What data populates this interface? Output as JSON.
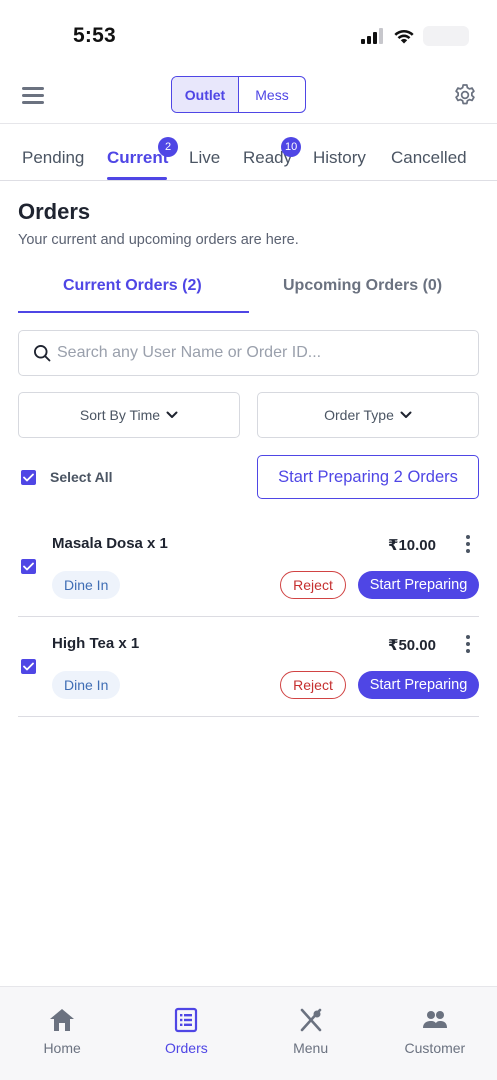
{
  "status_bar": {
    "time": "5:53"
  },
  "header": {
    "segments": [
      "Outlet",
      "Mess"
    ],
    "active_segment": "Outlet"
  },
  "tabs": [
    {
      "label": "Pending"
    },
    {
      "label": "Current",
      "badge": "2"
    },
    {
      "label": "Live"
    },
    {
      "label": "Ready",
      "badge": "10"
    },
    {
      "label": "History"
    },
    {
      "label": "Cancelled"
    }
  ],
  "active_tab": "Current",
  "page": {
    "title": "Orders",
    "subtitle": "Your current and upcoming orders are here."
  },
  "sub_tabs": {
    "current": "Current Orders (2)",
    "upcoming": "Upcoming Orders (0)"
  },
  "search": {
    "placeholder": "Search any User Name or Order ID..."
  },
  "filters": {
    "sort": "Sort By Time",
    "type": "Order Type"
  },
  "select_all": {
    "label": "Select All",
    "checked": true
  },
  "bulk_action": {
    "label": "Start Preparing 2 Orders"
  },
  "orders": [
    {
      "name": "Masala Dosa x 1",
      "price": "₹10.00",
      "tag": "Dine In",
      "reject": "Reject",
      "start": "Start Preparing",
      "checked": true
    },
    {
      "name": "High Tea x 1",
      "price": "₹50.00",
      "tag": "Dine In",
      "reject": "Reject",
      "start": "Start Preparing",
      "checked": true
    }
  ],
  "bottom_nav": [
    {
      "label": "Home",
      "icon": "home-icon"
    },
    {
      "label": "Orders",
      "icon": "orders-icon",
      "active": true
    },
    {
      "label": "Menu",
      "icon": "utensils-icon"
    },
    {
      "label": "Customer",
      "icon": "people-icon"
    }
  ],
  "colors": {
    "accent": "#4f46e5",
    "danger": "#c53030",
    "chip_bg": "#eef3fb"
  }
}
